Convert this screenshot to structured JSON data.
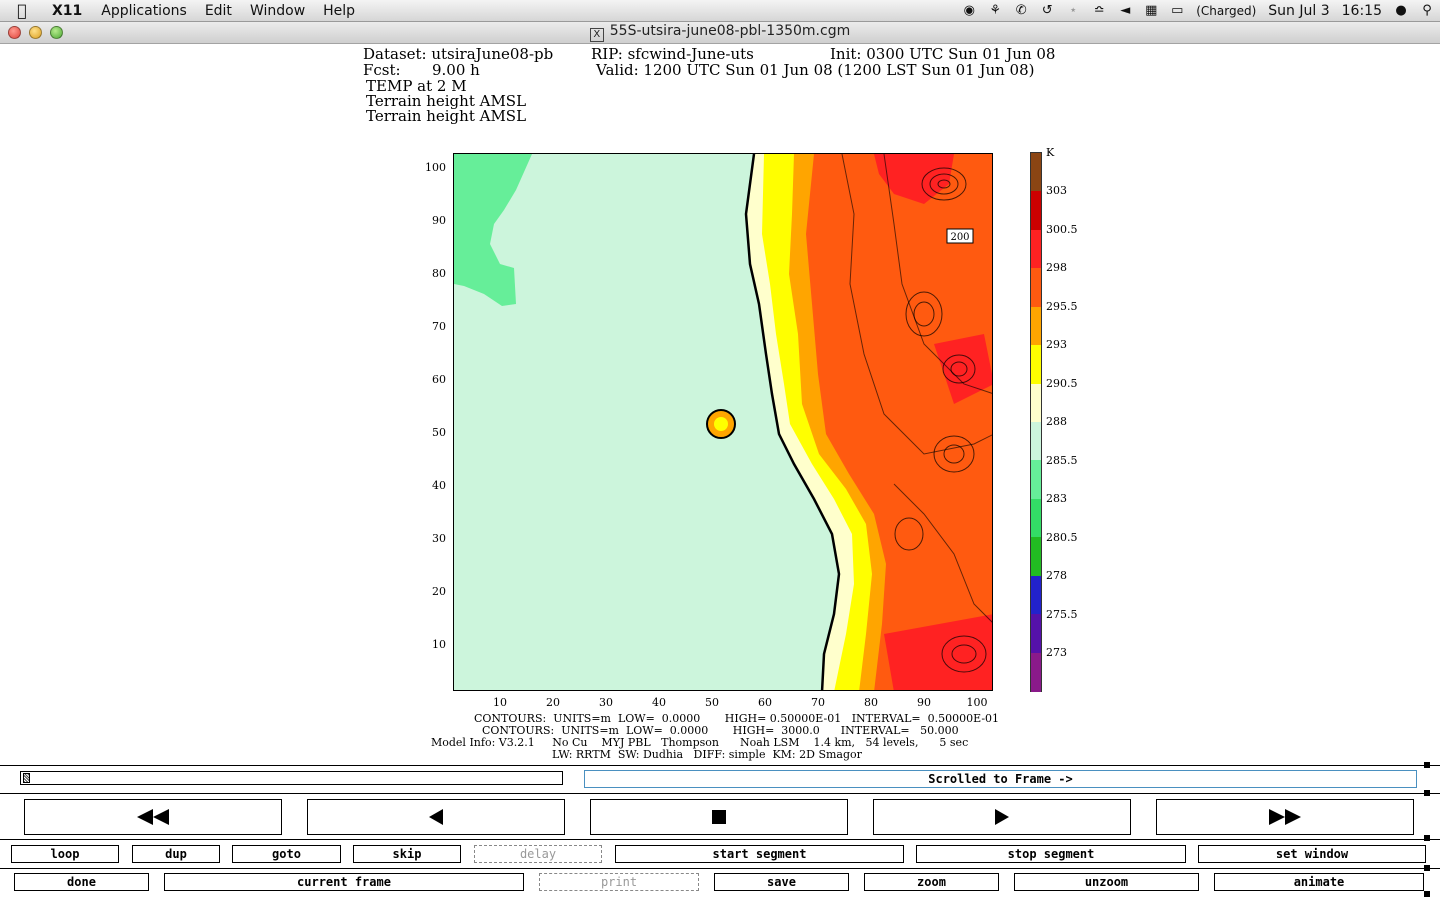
{
  "menubar": {
    "app": "X11",
    "items": [
      "Applications",
      "Edit",
      "Window",
      "Help"
    ],
    "battery": "(Charged)",
    "date": "Sun Jul 3",
    "time": "16:15"
  },
  "window": {
    "title": "55S-utsira-june08-pbl-1350m.cgm"
  },
  "header": {
    "line1_left": "Dataset: utsiraJune08-pb",
    "line1_mid": "RIP: sfcwind-June-uts",
    "line1_right": "Init: 0300 UTC Sun 01 Jun 08",
    "fcst_label": "Fcst:",
    "fcst_value": "9.00 h",
    "valid": "Valid: 1200 UTC Sun 01 Jun 08 (1200 LST Sun 01 Jun 08)",
    "field1": "TEMP at 2 M",
    "field2": "Terrain height AMSL",
    "field3": "Terrain height AMSL"
  },
  "chart_data": {
    "type": "heatmap",
    "xticks": [
      "10",
      "20",
      "30",
      "40",
      "50",
      "60",
      "70",
      "80",
      "90",
      "100"
    ],
    "yticks": [
      "100",
      "90",
      "80",
      "70",
      "60",
      "50",
      "40",
      "30",
      "20",
      "10"
    ],
    "xlim": [
      1,
      102
    ],
    "ylim": [
      1,
      102
    ],
    "contour_label": "200",
    "colorbar": {
      "unit": "K",
      "labels": [
        "303",
        "300.5",
        "298",
        "295.5",
        "293",
        "290.5",
        "288",
        "285.5",
        "283",
        "280.5",
        "278",
        "275.5",
        "273"
      ],
      "colors": [
        "#8b4513",
        "#cc0000",
        "#ff2222",
        "#ff5a10",
        "#ffa500",
        "#ffff00",
        "#ffffcc",
        "#ccf5dc",
        "#66ee99",
        "#33dd66",
        "#22bb22",
        "#2222cc",
        "#5511aa",
        "#8a1a8a"
      ]
    }
  },
  "footer": {
    "line1": "CONTOURS:  UNITS=m  LOW=  0.0000       HIGH= 0.50000E-01   INTERVAL=  0.50000E-01",
    "line2": "CONTOURS:  UNITS=m  LOW=  0.0000       HIGH=  3000.0      INTERVAL=   50.000",
    "line3": "Model Info: V3.2.1     No Cu    MYJ PBL   Thompson      Noah LSM    1.4 km,   54 levels,      5 sec",
    "line4": "LW: RRTM  SW: Dudhia   DIFF: simple  KM: 2D Smagor"
  },
  "controls": {
    "status": "Scrolled to Frame ->",
    "row1": [
      "loop",
      "dup",
      "goto",
      "skip",
      "delay",
      "start segment",
      "stop segment",
      "set window"
    ],
    "row2": [
      "done",
      "current frame",
      "print",
      "save",
      "zoom",
      "unzoom",
      "animate"
    ]
  }
}
